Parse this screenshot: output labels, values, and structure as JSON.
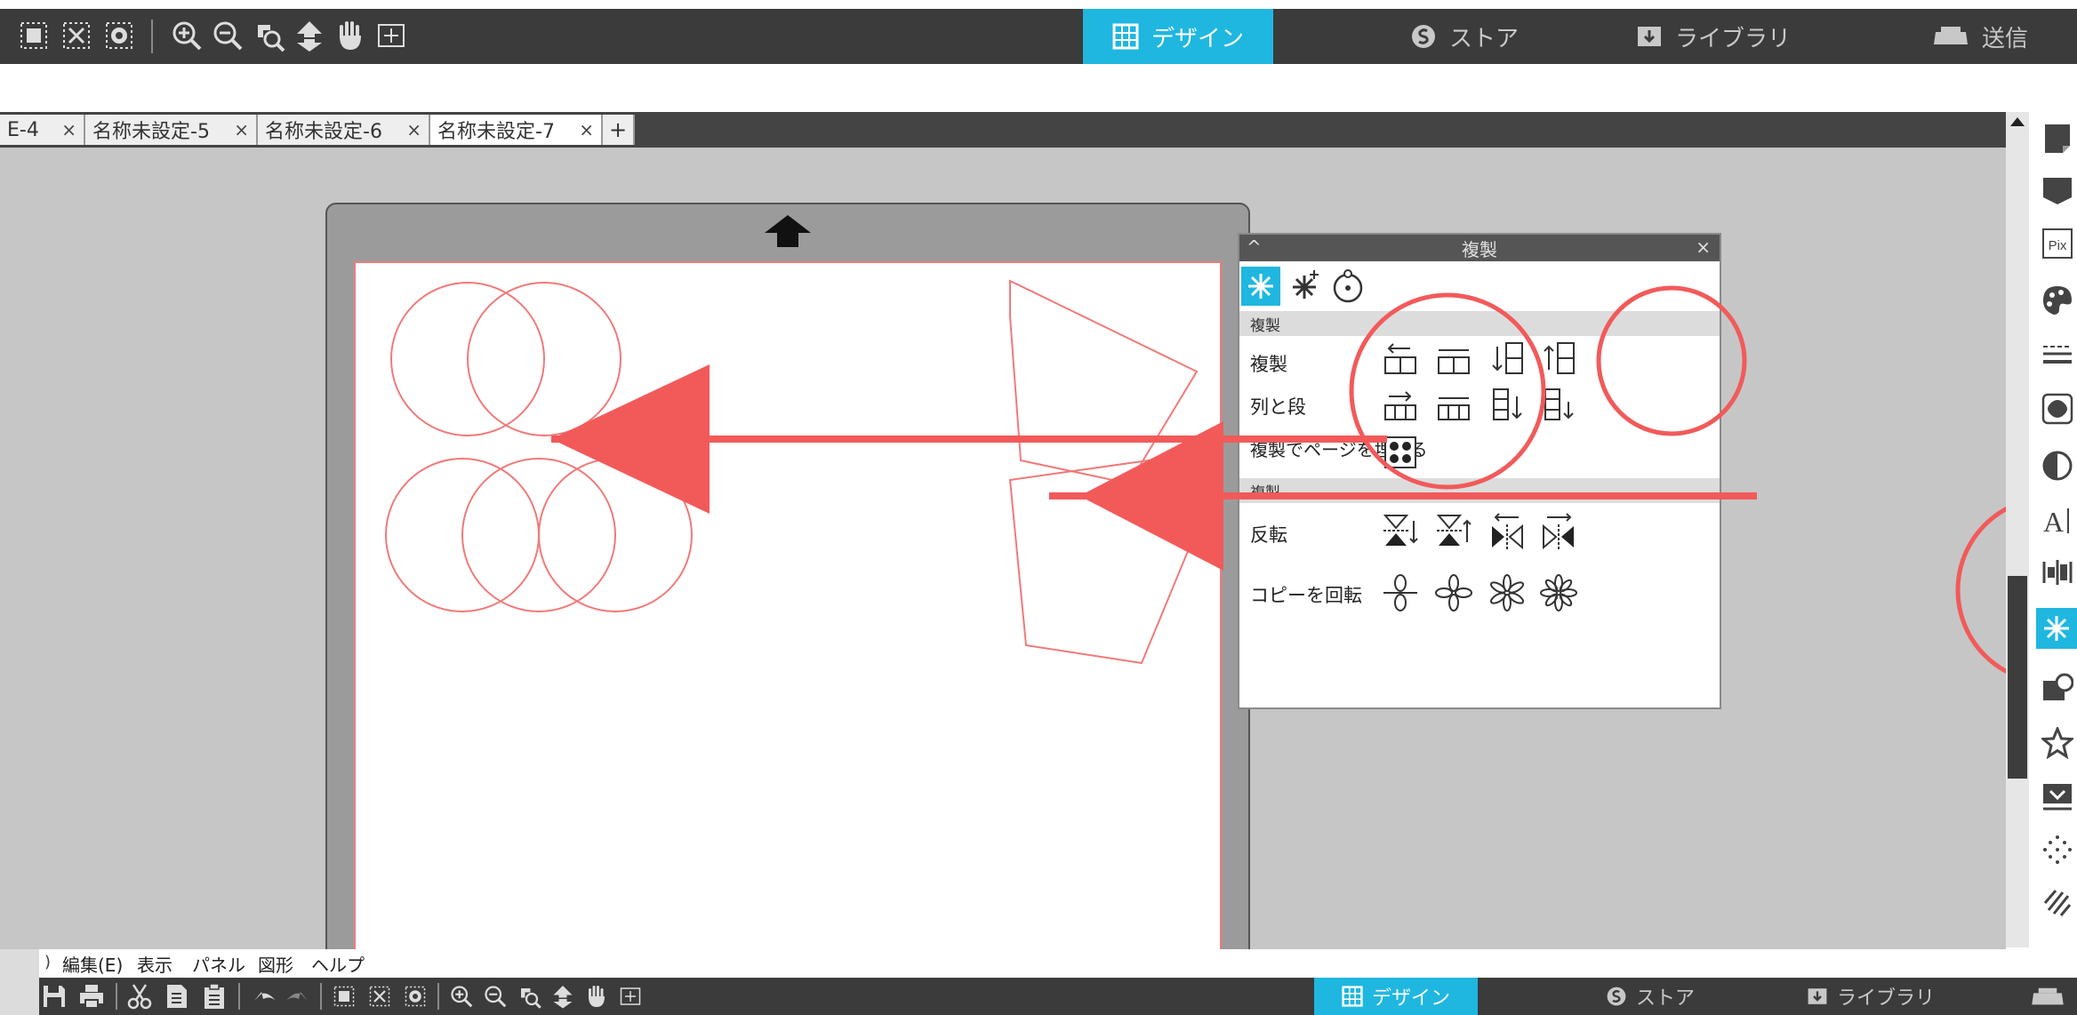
{
  "top_toolbar": {
    "tools": [
      "group-icon",
      "ungroup-icon",
      "compound-icon",
      "zoom-in-icon",
      "zoom-out-icon",
      "zoom-select-icon",
      "move-to-top-icon",
      "pan-hand-icon",
      "fit-page-icon"
    ],
    "nav": {
      "design": "デザイン",
      "store": "ストア",
      "library": "ライブラリ",
      "send": "送信"
    }
  },
  "tabs": [
    {
      "label": "E-4",
      "close": "×"
    },
    {
      "label": "名称未設定-5",
      "close": "×"
    },
    {
      "label": "名称未設定-6",
      "close": "×"
    },
    {
      "label": "名称未設定-7",
      "close": "×"
    }
  ],
  "add_tab": "+",
  "panel": {
    "title": "複製",
    "close": "×",
    "collapse": "^",
    "section1": "複製",
    "row_duplicate": "複製",
    "row_row_col": "列と段",
    "row_fill_page": "複製でページを埋める",
    "section2": "複製",
    "row_mirror": "反転",
    "row_rotate_copy": "コピーを回転"
  },
  "menu": {
    "edit": "編集(E)",
    "view": "表示",
    "panel": "パネル",
    "shape": "図形",
    "help": "ヘルプ"
  },
  "bottom_nav": {
    "design": "デザイン",
    "store": "ストア",
    "library": "ライブラリ"
  },
  "colors": {
    "accent": "#1fb7e0",
    "toolbar": "#3b3b3b",
    "annotation": "#f25a5a",
    "shape_stroke": "#f07a7a"
  }
}
